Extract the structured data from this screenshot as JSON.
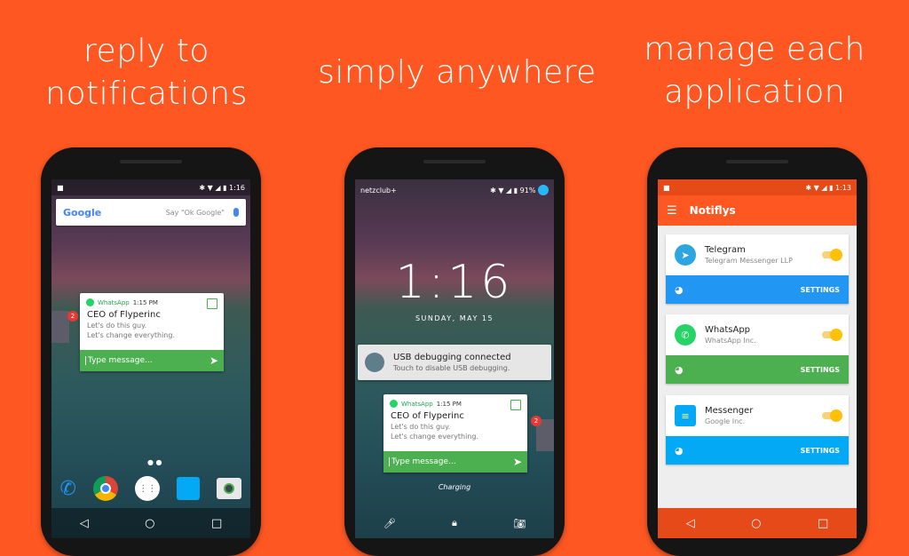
{
  "headlines": {
    "left": [
      "reply to",
      "notifications"
    ],
    "center": "simply anywhere",
    "right": [
      "manage each",
      "application"
    ]
  },
  "phone1": {
    "time": "1:16",
    "search_brand": "Google",
    "search_hint": "Say \"Ok Google\"",
    "notification": {
      "app": "WhatsApp",
      "time": "1:15 PM",
      "title": "CEO of Flyperinc",
      "lines": [
        "Let's do this guy.",
        "Let's change everything."
      ],
      "reply_placeholder": "Type message...",
      "badge": "2"
    }
  },
  "phone2": {
    "carrier": "netzclub+",
    "battery": "91%",
    "clock": "1:16",
    "date": "SUNDAY, MAY 15",
    "usb": {
      "title": "USB debugging connected",
      "subtitle": "Touch to disable USB debugging."
    },
    "notification": {
      "app": "WhatsApp",
      "time": "1:15 PM",
      "title": "CEO of Flyperinc",
      "lines": [
        "Let's do this guy.",
        "Let's change everything."
      ],
      "reply_placeholder": "Type message...",
      "badge": "2"
    },
    "charging": "Charging"
  },
  "phone3": {
    "time": "1:13",
    "app_title": "Notiflys",
    "apps": [
      {
        "name": "Telegram",
        "publisher": "Telegram Messenger LLP",
        "settings": "SETTINGS",
        "color": "#2196F3"
      },
      {
        "name": "WhatsApp",
        "publisher": "WhatsApp Inc.",
        "settings": "SETTINGS",
        "color": "#4CAF50"
      },
      {
        "name": "Messenger",
        "publisher": "Google Inc.",
        "settings": "SETTINGS",
        "color": "#03A9F4"
      }
    ]
  },
  "colors": {
    "background": "#FF5722",
    "whatsapp_green": "#4CAF50",
    "toolbar_orange": "#FF5722"
  }
}
